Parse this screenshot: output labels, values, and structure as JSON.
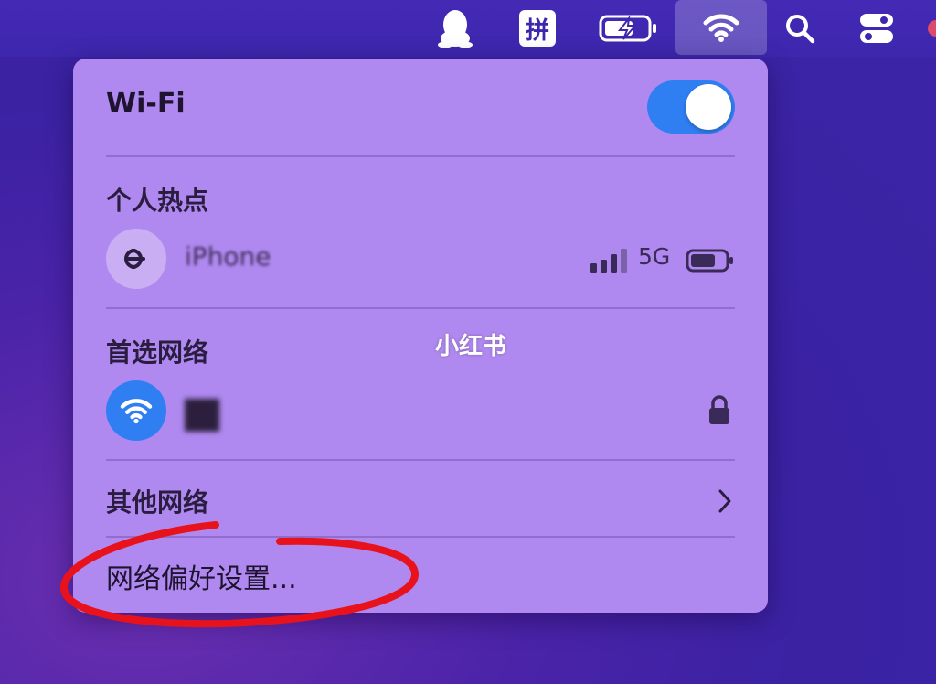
{
  "menubar": {
    "items": [
      {
        "name": "qq-penguin-icon"
      },
      {
        "name": "pinyin-input",
        "label": "拼"
      },
      {
        "name": "battery-charging-icon"
      },
      {
        "name": "wifi-icon"
      },
      {
        "name": "search-icon"
      },
      {
        "name": "control-center-icon"
      }
    ]
  },
  "wifi_panel": {
    "title": "Wi-Fi",
    "toggle_on": true,
    "hotspot_section": "个人热点",
    "hotspot_device": {
      "name_visible": "iPhone",
      "network_type": "5G"
    },
    "preferred_section": "首选网络",
    "other_networks": "其他网络",
    "preferences_link": "网络偏好设置..."
  },
  "watermark": "小红书",
  "colors": {
    "panel_bg": "#b089f0",
    "toggle_on": "#2f7ff2",
    "wifi_circle": "#2f7ff2",
    "annotation_red": "#e8121c"
  }
}
